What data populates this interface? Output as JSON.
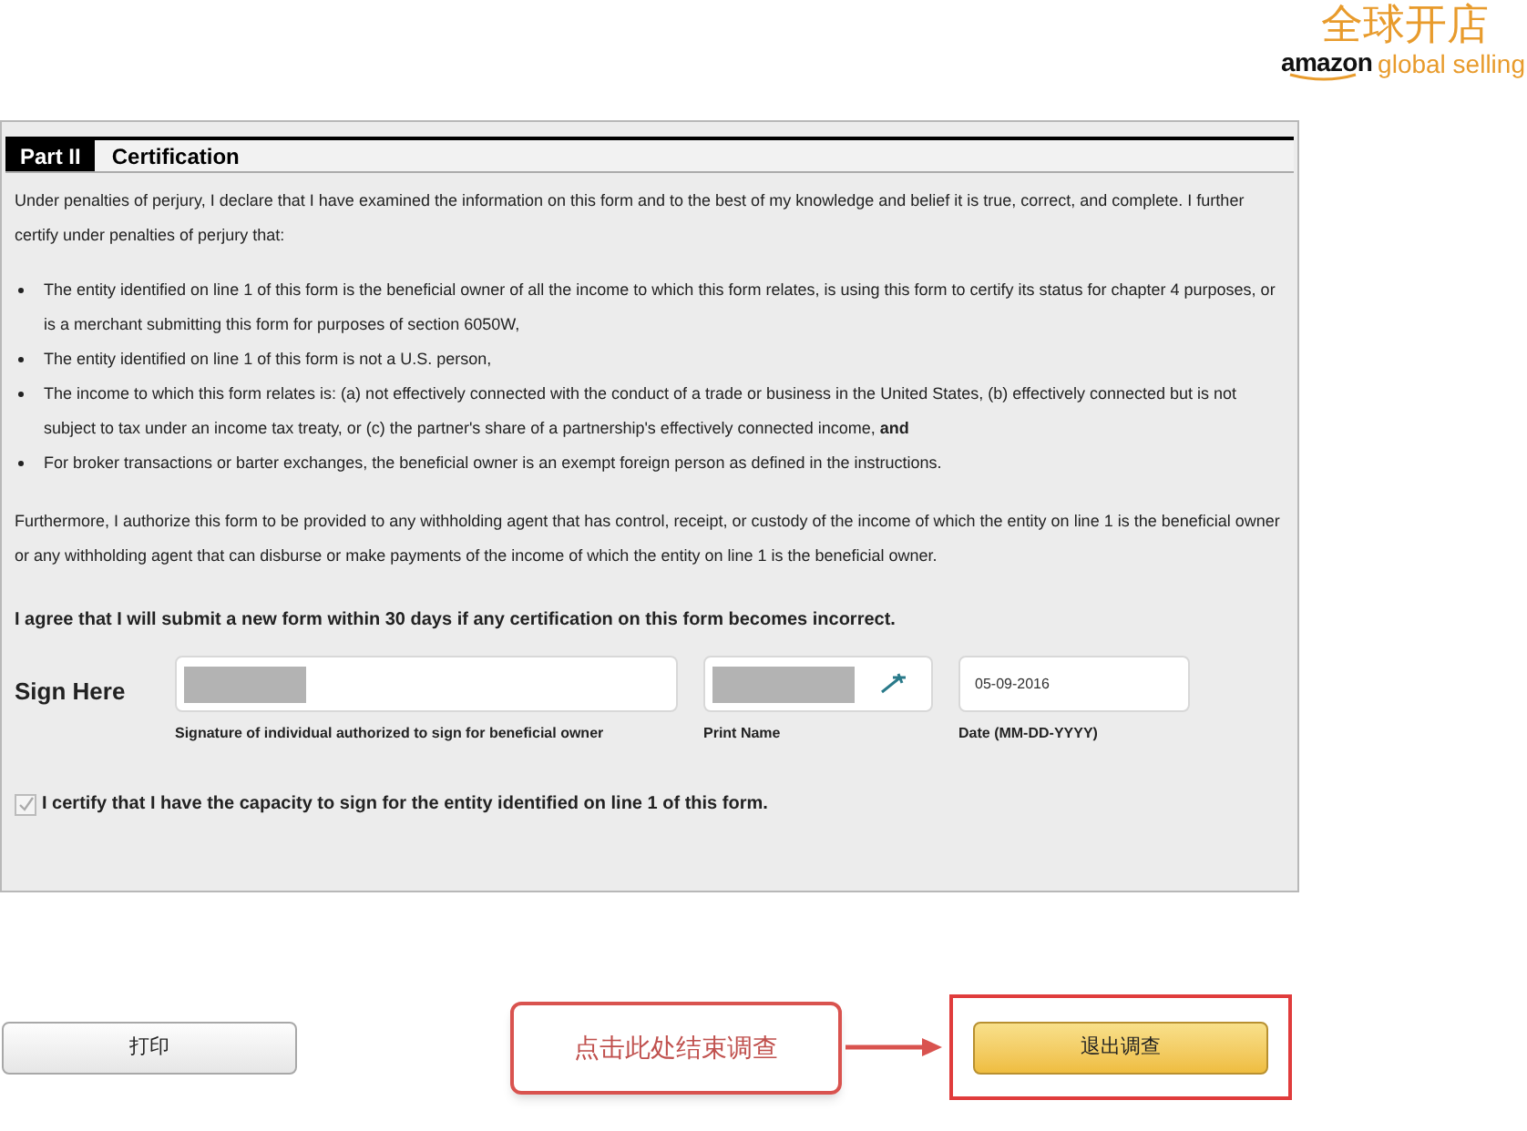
{
  "logo": {
    "title": "全球开店",
    "brand": "amazon",
    "tagline": "global selling"
  },
  "form": {
    "part": "Part II",
    "title": "Certification",
    "intro": "Under penalties of perjury, I declare that I have examined the information on this form and to the best of my knowledge and belief it is true, correct, and complete. I further certify under penalties of perjury that:",
    "bullets": [
      "The entity identified on line 1 of this form is the beneficial owner of all the income to which this form relates, is using this form to certify its status for chapter 4 purposes, or is a merchant submitting this form for purposes of section 6050W,",
      "The entity identified on line 1 of this form is not a U.S. person,",
      "The income to which this form relates is: (a) not effectively connected with the conduct of a trade or business in the United States, (b) effectively connected but is not subject to tax under an income tax treaty, or (c) the partner's share of a partnership's effectively connected income, **and**",
      "For broker transactions or barter exchanges, the beneficial owner is an exempt foreign person as defined in the instructions."
    ],
    "authorization": "Furthermore, I authorize this form to be provided to any withholding agent that has control, receipt, or custody of the income of which the entity on line 1 is the beneficial owner or any withholding agent that can disburse or make payments of the income of which the entity on line 1 is the beneficial owner.",
    "agreement": "I agree that I will submit a new form within 30 days if any certification on this form becomes incorrect.",
    "sign_label": "Sign Here",
    "fields": [
      {
        "kind": "redacted",
        "caption": "Signature of individual authorized to sign for beneficial owner"
      },
      {
        "kind": "redacted_pen",
        "caption": "Print Name"
      },
      {
        "kind": "text",
        "value": "05-09-2016",
        "caption": "Date (MM-DD-YYYY)"
      }
    ],
    "capacity": {
      "label": "I certify that I have the capacity to sign for the entity identified on line 1 of this form.",
      "checked": true,
      "disabled": true
    }
  },
  "buttons": {
    "print": "打印",
    "callout": "点击此处结束调查",
    "exit": "退出调查"
  }
}
